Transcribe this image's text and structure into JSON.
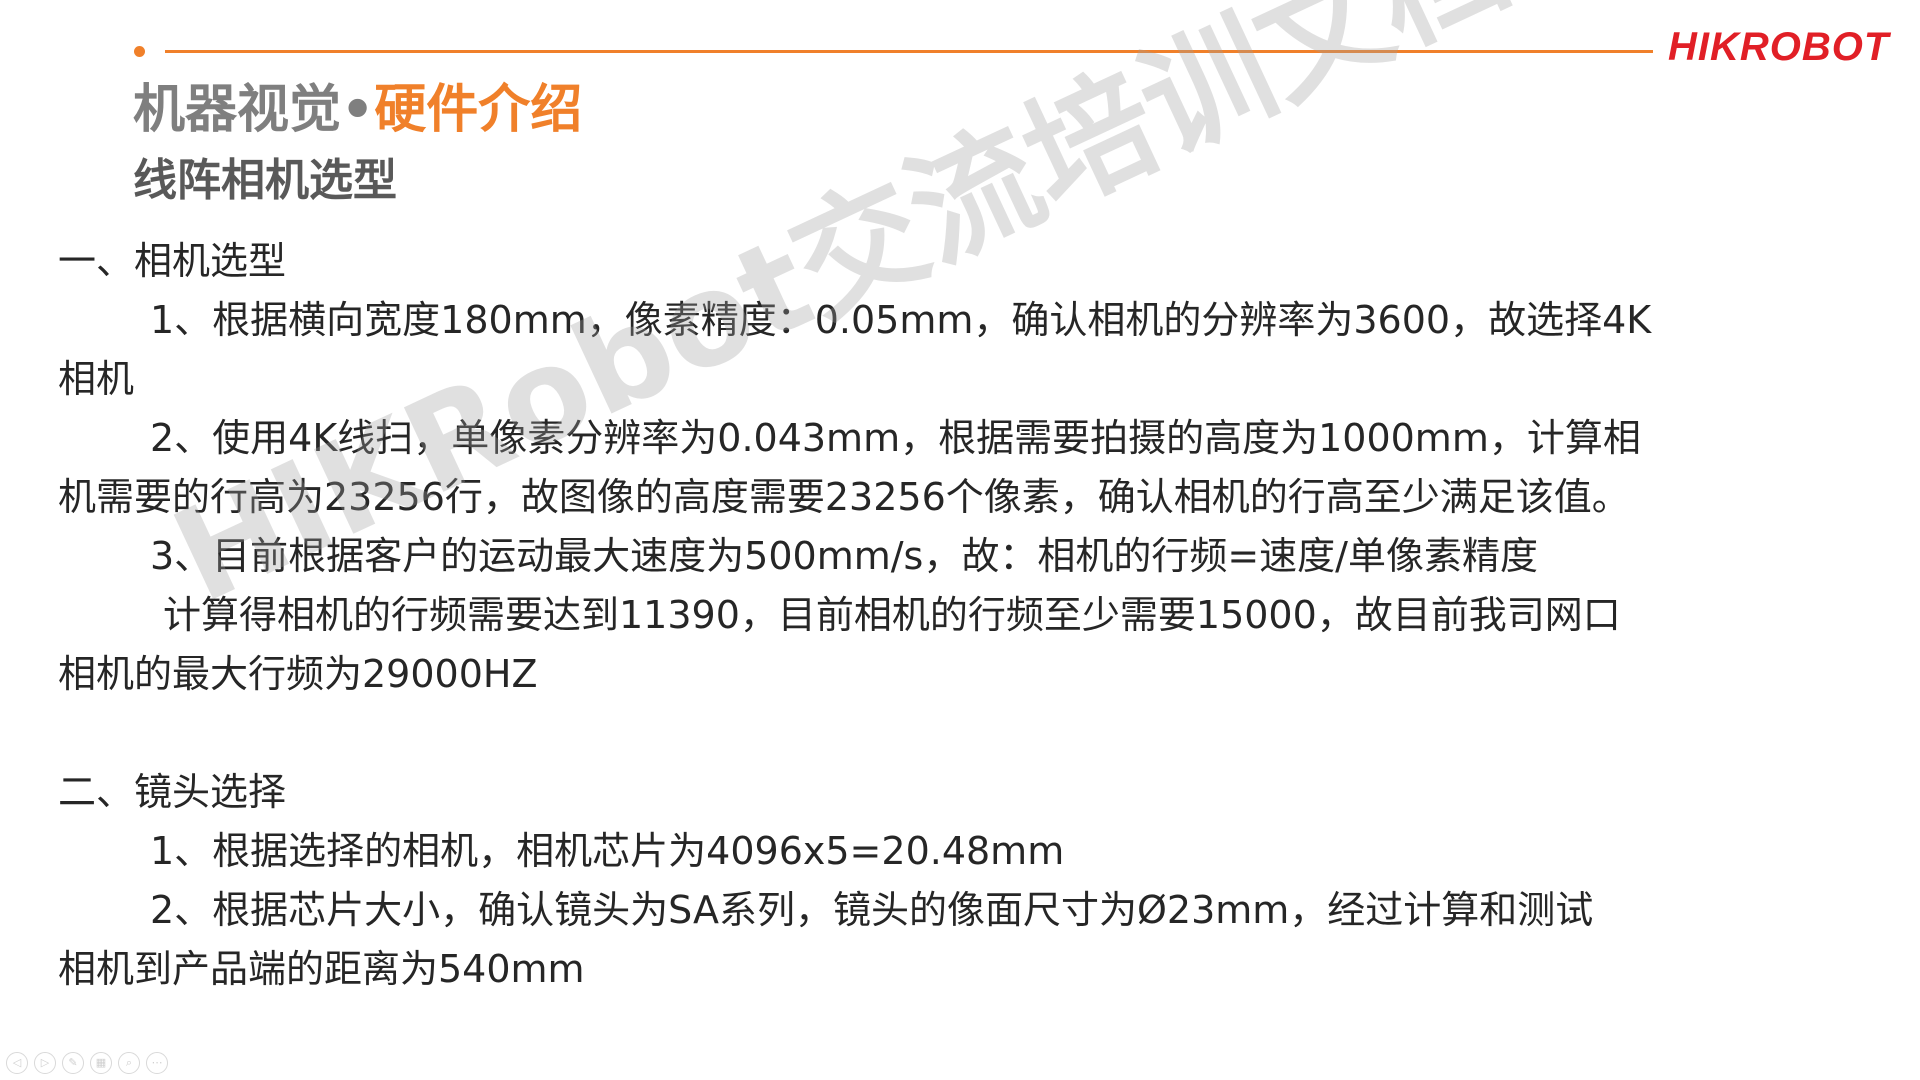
{
  "header": {
    "logo_part1": "HIK",
    "logo_part2": "ROBOT",
    "title_part1": "机器视觉•",
    "title_part2": "硬件介绍",
    "subtitle": "线阵相机选型"
  },
  "watermark": "HIKRobot交流培训文档",
  "content": {
    "section1_heading": "一、相机选型",
    "s1_line1": "1、根据横向宽度180mm，像素精度：0.05mm，确认相机的分辨率为3600，故选择4K",
    "s1_line2": "相机",
    "s1_line3": "2、使用4K线扫，单像素分辨率为0.043mm，根据需要拍摄的高度为1000mm，计算相",
    "s1_line4": "机需要的行高为23256行，故图像的高度需要23256个像素，确认相机的行高至少满足该值。",
    "s1_line5": "3、目前根据客户的运动最大速度为500mm/s，故：相机的行频=速度/单像素精度",
    "s1_line6": "计算得相机的行频需要达到11390，目前相机的行频至少需要15000，故目前我司网口",
    "s1_line7": "相机的最大行频为29000HZ",
    "section2_heading": "二、镜头选择",
    "s2_line1": "1、根据选择的相机，相机芯片为4096x5=20.48mm",
    "s2_line2": "2、根据芯片大小，确认镜头为SA系列，镜头的像面尺寸为Ø23mm，经过计算和测试",
    "s2_line3": "相机到产品端的距离为540mm"
  },
  "toolbar": {
    "prev_icon": "◁",
    "next_icon": "▷",
    "pen_icon": "✎",
    "slides_icon": "▦",
    "zoom_icon": "⌕",
    "more_icon": "⋯"
  },
  "colors": {
    "accent": "#F0802A",
    "brand": "#E11F26",
    "title_grey": "#7F7F7F"
  }
}
